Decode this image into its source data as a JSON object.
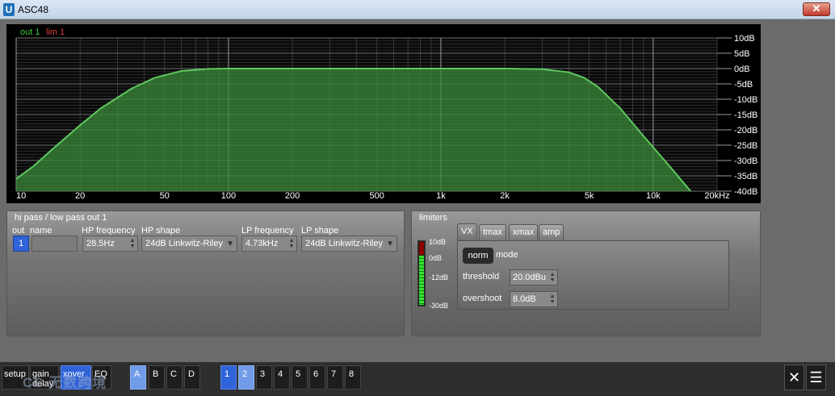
{
  "window": {
    "title": "ASC48",
    "close_glyph": "✕"
  },
  "graph": {
    "legend": {
      "out": "out 1",
      "lim": "lim 1"
    },
    "x_labels": [
      "10",
      "20",
      "50",
      "100",
      "200",
      "500",
      "1k",
      "2k",
      "5k",
      "10k",
      "20kHz"
    ],
    "y_labels": [
      "10dB",
      "5dB",
      "0dB",
      "-5dB",
      "-10dB",
      "-15dB",
      "-20dB",
      "-25dB",
      "-30dB",
      "-35dB",
      "-40dB"
    ],
    "fill_color": "#3a8a3a",
    "line_color": "#5ec95e"
  },
  "chart_data": {
    "type": "area",
    "xlabel": "",
    "ylabel": "",
    "xscale": "log",
    "xlim": [
      10,
      20000
    ],
    "ylim": [
      -40,
      10
    ],
    "series": [
      {
        "name": "out 1",
        "x": [
          10,
          12,
          15,
          20,
          25,
          28.5,
          35,
          45,
          60,
          80,
          100,
          200,
          500,
          1000,
          2000,
          3000,
          4000,
          4730,
          5500,
          7000,
          9000,
          12000,
          15000
        ],
        "y": [
          -36,
          -32,
          -26,
          -18.5,
          -13,
          -10.5,
          -6.5,
          -3,
          -0.8,
          -0.1,
          0,
          0,
          0,
          0,
          0,
          -0.2,
          -1.2,
          -3,
          -6,
          -13,
          -22,
          -32,
          -40
        ]
      }
    ]
  },
  "xover": {
    "title": "hi pass / low pass out 1",
    "col_out": "out",
    "col_name": "name",
    "col_hp_freq": "HP frequency",
    "col_hp_shape": "HP shape",
    "col_lp_freq": "LP frequency",
    "col_lp_shape": "LP shape",
    "out_value": "1",
    "name_value": "",
    "hp_freq": "28.5Hz",
    "hp_shape": "24dB Linkwitz-Riley",
    "lp_freq": "4.73kHz",
    "lp_shape": "24dB Linkwitz-Riley"
  },
  "limiters": {
    "title": "limiters",
    "meter_labels": [
      "10dB",
      "0dB",
      "-12dB",
      "-30dB"
    ],
    "tabs": [
      "VX",
      "tmax",
      "xmax",
      "amp"
    ],
    "mode_button": "norm",
    "mode_label": "mode",
    "threshold_label": "threshold",
    "threshold_value": "20.0dBu",
    "overshoot_label": "overshoot",
    "overshoot_value": "8.0dB"
  },
  "bottombar": {
    "setup": "setup",
    "gain": "gain",
    "delay": "delay",
    "xover": "xover",
    "eq": "EQ",
    "groups": [
      "A",
      "B",
      "C",
      "D"
    ],
    "channels": [
      "1",
      "2",
      "3",
      "4",
      "5",
      "6",
      "7",
      "8"
    ],
    "watermark": "CC 无数跨境"
  }
}
